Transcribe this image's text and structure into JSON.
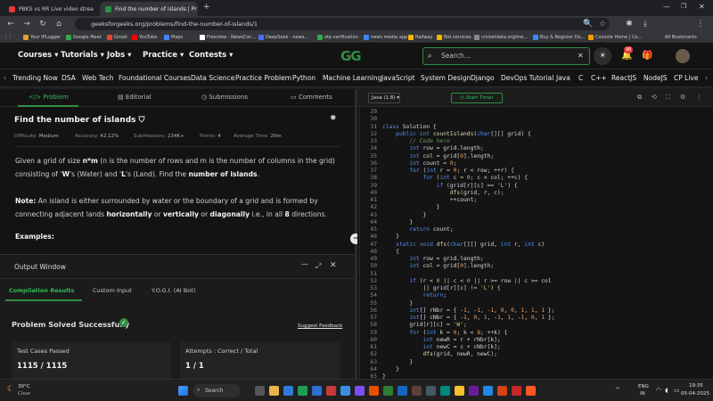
{
  "browser": {
    "tabs": [
      {
        "title": "PBKS vs RR Live video strea"
      },
      {
        "title": "Find the number of islands | Pr"
      }
    ],
    "new_tab": "+",
    "url": "geeksforgeeks.org/problems/find-the-number-of-islands/1",
    "bookmarks": [
      "Your IPLugger",
      "Google Meet",
      "Gmail",
      "YouTube",
      "Maps",
      "Freeview - NewsCon...",
      "DeepSeek - news...",
      "otp verification",
      "news media app",
      "Railway",
      "Bot services",
      "cricketdata.org/me...",
      "Buy & Register Do...",
      "Console Home | Co...",
      "All Bookmarks"
    ]
  },
  "header": {
    "menu": [
      "Courses",
      "Tutorials",
      "Jobs",
      "Practice",
      "Contests"
    ],
    "logo": "GG",
    "search_placeholder": "Search...",
    "notif_count": "96"
  },
  "topics": [
    "Trending Now",
    "DSA",
    "Web Tech",
    "Foundational Courses",
    "Data Science",
    "Practice Problem",
    "Python",
    "Machine Learning",
    "JavaScript",
    "System Design",
    "Django",
    "DevOps Tutorial",
    "Java",
    "C",
    "C++",
    "ReactJS",
    "NodeJS",
    "CP Live"
  ],
  "problem_tabs": [
    "Problem",
    "Editorial",
    "Submissions",
    "Comments"
  ],
  "problem": {
    "title": "Find the number of islands",
    "meta": [
      {
        "label": "Difficulty:",
        "value": "Medium"
      },
      {
        "label": "Accuracy:",
        "value": "42.12%"
      },
      {
        "label": "Submissions:",
        "value": "234K+"
      },
      {
        "label": "Points:",
        "value": "4"
      },
      {
        "label": "Average Time:",
        "value": "20m"
      }
    ],
    "p1_a": "Given a grid of size ",
    "p1_b": "n*m",
    "p1_c": " (n is the number of rows and m is the number of columns in the grid) consisting of '",
    "p1_d": "W",
    "p1_e": "'s (Water) and '",
    "p1_f": "L",
    "p1_g": "'s (Land). Find the ",
    "p1_h": "number of islands",
    "p1_i": ".",
    "p2_a": "Note:",
    "p2_b": " An island is either surrounded by water or the boundary of a grid and is formed by connecting adjacent lands ",
    "p2_c": "horizontally",
    "p2_d": " or ",
    "p2_e": "vertically",
    "p2_f": " or ",
    "p2_g": "diagonally",
    "p2_h": " i.e., in all ",
    "p2_i": "8",
    "p2_j": " directions.",
    "examples": "Examples:"
  },
  "output": {
    "title": "Output Window",
    "tabs": [
      "Compilation Results",
      "Custom Input",
      "Y.O.G.I. (AI Bot)"
    ],
    "status": "Problem Solved Successfully",
    "feedback": "Suggest Feedback",
    "card1_label": "Test Cases Passed",
    "card1_value": "1115 / 1115",
    "card2_label": "Attempts : Correct / Total",
    "card2_value": "1 / 1"
  },
  "editor": {
    "language": "Java (1.8)",
    "timer": "Start Timer",
    "lines": [
      {
        "n": "29",
        "t": ""
      },
      {
        "n": "30",
        "t": ""
      },
      {
        "n": "31",
        "t": "class Solution {"
      },
      {
        "n": "32",
        "t": "    public int countIslands(char[][] grid) {"
      },
      {
        "n": "33",
        "t": "        // Code here"
      },
      {
        "n": "34",
        "t": "        int row = grid.length;"
      },
      {
        "n": "35",
        "t": "        int col = grid[0].length;"
      },
      {
        "n": "36",
        "t": "        int count = 0;"
      },
      {
        "n": "37",
        "t": "        for (int r = 0; r < row; ++r) {"
      },
      {
        "n": "38",
        "t": "            for (int c = 0; c < col; ++c) {"
      },
      {
        "n": "39",
        "t": "                if (grid[r][c] == 'L') {"
      },
      {
        "n": "40",
        "t": "                    dfs(grid, r, c);"
      },
      {
        "n": "41",
        "t": "                    ++count;"
      },
      {
        "n": "42",
        "t": "                }"
      },
      {
        "n": "43",
        "t": "            }"
      },
      {
        "n": "44",
        "t": "        }"
      },
      {
        "n": "45",
        "t": "        return count;"
      },
      {
        "n": "46",
        "t": "    }"
      },
      {
        "n": "47",
        "t": "    static void dfs(char[][] grid, int r, int c)"
      },
      {
        "n": "48",
        "t": "    {"
      },
      {
        "n": "49",
        "t": "        int row = grid.length;"
      },
      {
        "n": "50",
        "t": "        int col = grid[0].length;"
      },
      {
        "n": "51",
        "t": ""
      },
      {
        "n": "52",
        "t": "        if (r < 0 || c < 0 || r >= row || c >= col"
      },
      {
        "n": "53",
        "t": "            || grid[r][c] != 'L') {"
      },
      {
        "n": "54",
        "t": "            return;"
      },
      {
        "n": "55",
        "t": "        }"
      },
      {
        "n": "56",
        "t": "        int[] rNbr = { -1, -1, -1, 0, 0, 1, 1, 1 };"
      },
      {
        "n": "57",
        "t": "        int[] cNbr = { -1, 0, 1, -1, 1, -1, 0, 1 };"
      },
      {
        "n": "58",
        "t": "        grid[r][c] = 'W';"
      },
      {
        "n": "59",
        "t": "        for (int k = 0; k < 8; ++k) {"
      },
      {
        "n": "60",
        "t": "            int newR = r + rNbr[k];"
      },
      {
        "n": "61",
        "t": "            int newC = c + cNbr[k];"
      },
      {
        "n": "62",
        "t": "            dfs(grid, newR, newC);"
      },
      {
        "n": "63",
        "t": "        }"
      },
      {
        "n": "64",
        "t": "    }"
      },
      {
        "n": "65",
        "t": "}"
      }
    ]
  },
  "taskbar": {
    "weather_temp": "30°C",
    "weather_text": "Clear",
    "search": "Search",
    "lang1": "ENG",
    "lang2": "IN",
    "time": "19:35",
    "date": "05-04-2025"
  },
  "colors": {
    "accent": "#2f8d46",
    "bg": "#131313",
    "keyword": "#4f8ff7",
    "type": "#ff79c6",
    "number": "#f0a05a",
    "string": "#e2c96a",
    "comment": "#6a9955"
  }
}
